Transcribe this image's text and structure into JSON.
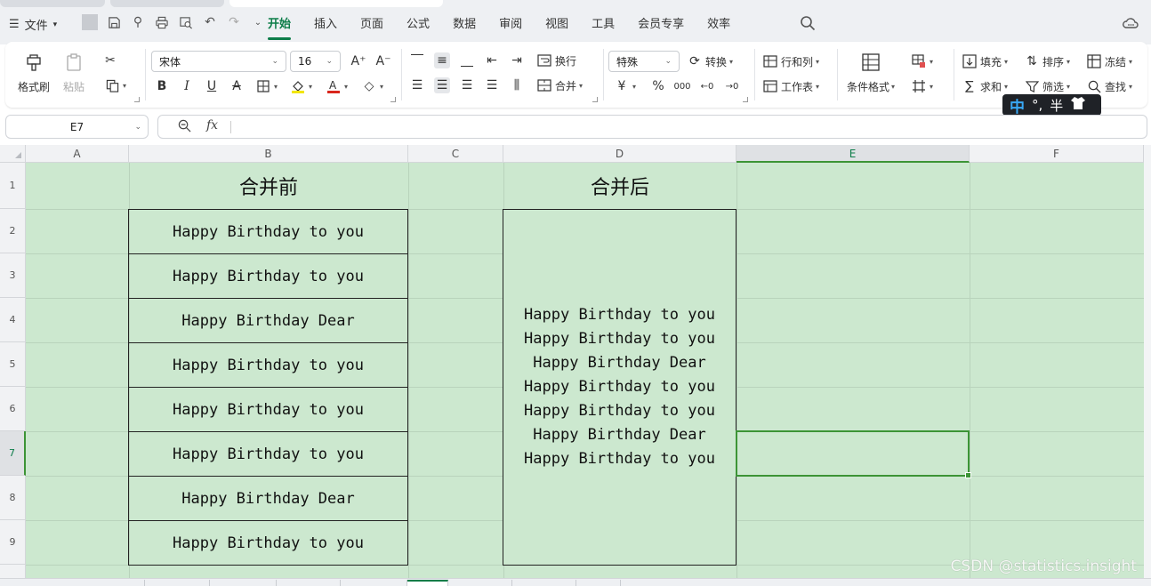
{
  "menu": {
    "file_label": "文件",
    "tabs": [
      "开始",
      "插入",
      "页面",
      "公式",
      "数据",
      "审阅",
      "视图",
      "工具",
      "会员专享",
      "效率"
    ],
    "active_tab": "开始"
  },
  "ribbon": {
    "format_painter": "格式刷",
    "paste": "粘贴",
    "font_name": "宋体",
    "font_size": "16",
    "wrap_text": "换行",
    "merge": "合并",
    "number_format": "特殊",
    "convert": "转换",
    "row_col": "行和列",
    "worksheet": "工作表",
    "conditional_format": "条件格式",
    "fill": "填充",
    "sort": "排序",
    "freeze": "冻结",
    "sum": "求和",
    "filter": "筛选",
    "find": "查找"
  },
  "ime": {
    "mode": "中",
    "punct": "°,",
    "width": "半"
  },
  "formula_bar": {
    "cell_ref": "E7",
    "fx": "fx",
    "content": ""
  },
  "sheet": {
    "columns": [
      "A",
      "B",
      "C",
      "D",
      "E",
      "F"
    ],
    "rows": [
      "1",
      "2",
      "3",
      "4",
      "5",
      "6",
      "7",
      "8",
      "9"
    ],
    "selected_column": "E",
    "selected_row": "7",
    "b_header": "合并前",
    "d_header": "合并后",
    "b_cells": [
      "Happy Birthday to you",
      "Happy Birthday to you",
      "Happy Birthday Dear",
      "Happy Birthday to you",
      "Happy Birthday to you",
      "Happy Birthday to you",
      "Happy Birthday Dear",
      "Happy Birthday to you"
    ],
    "d_merged_lines": [
      "Happy Birthday to you",
      "Happy Birthday to you",
      "Happy Birthday Dear",
      "Happy Birthday to you",
      "Happy Birthday to you",
      "Happy Birthday Dear",
      "Happy Birthday to you"
    ]
  },
  "watermark": "CSDN @statistics.insight",
  "colors": {
    "accent": "#0d7d49",
    "cell_bg": "#cce8cf",
    "selection": "#3c9436"
  }
}
